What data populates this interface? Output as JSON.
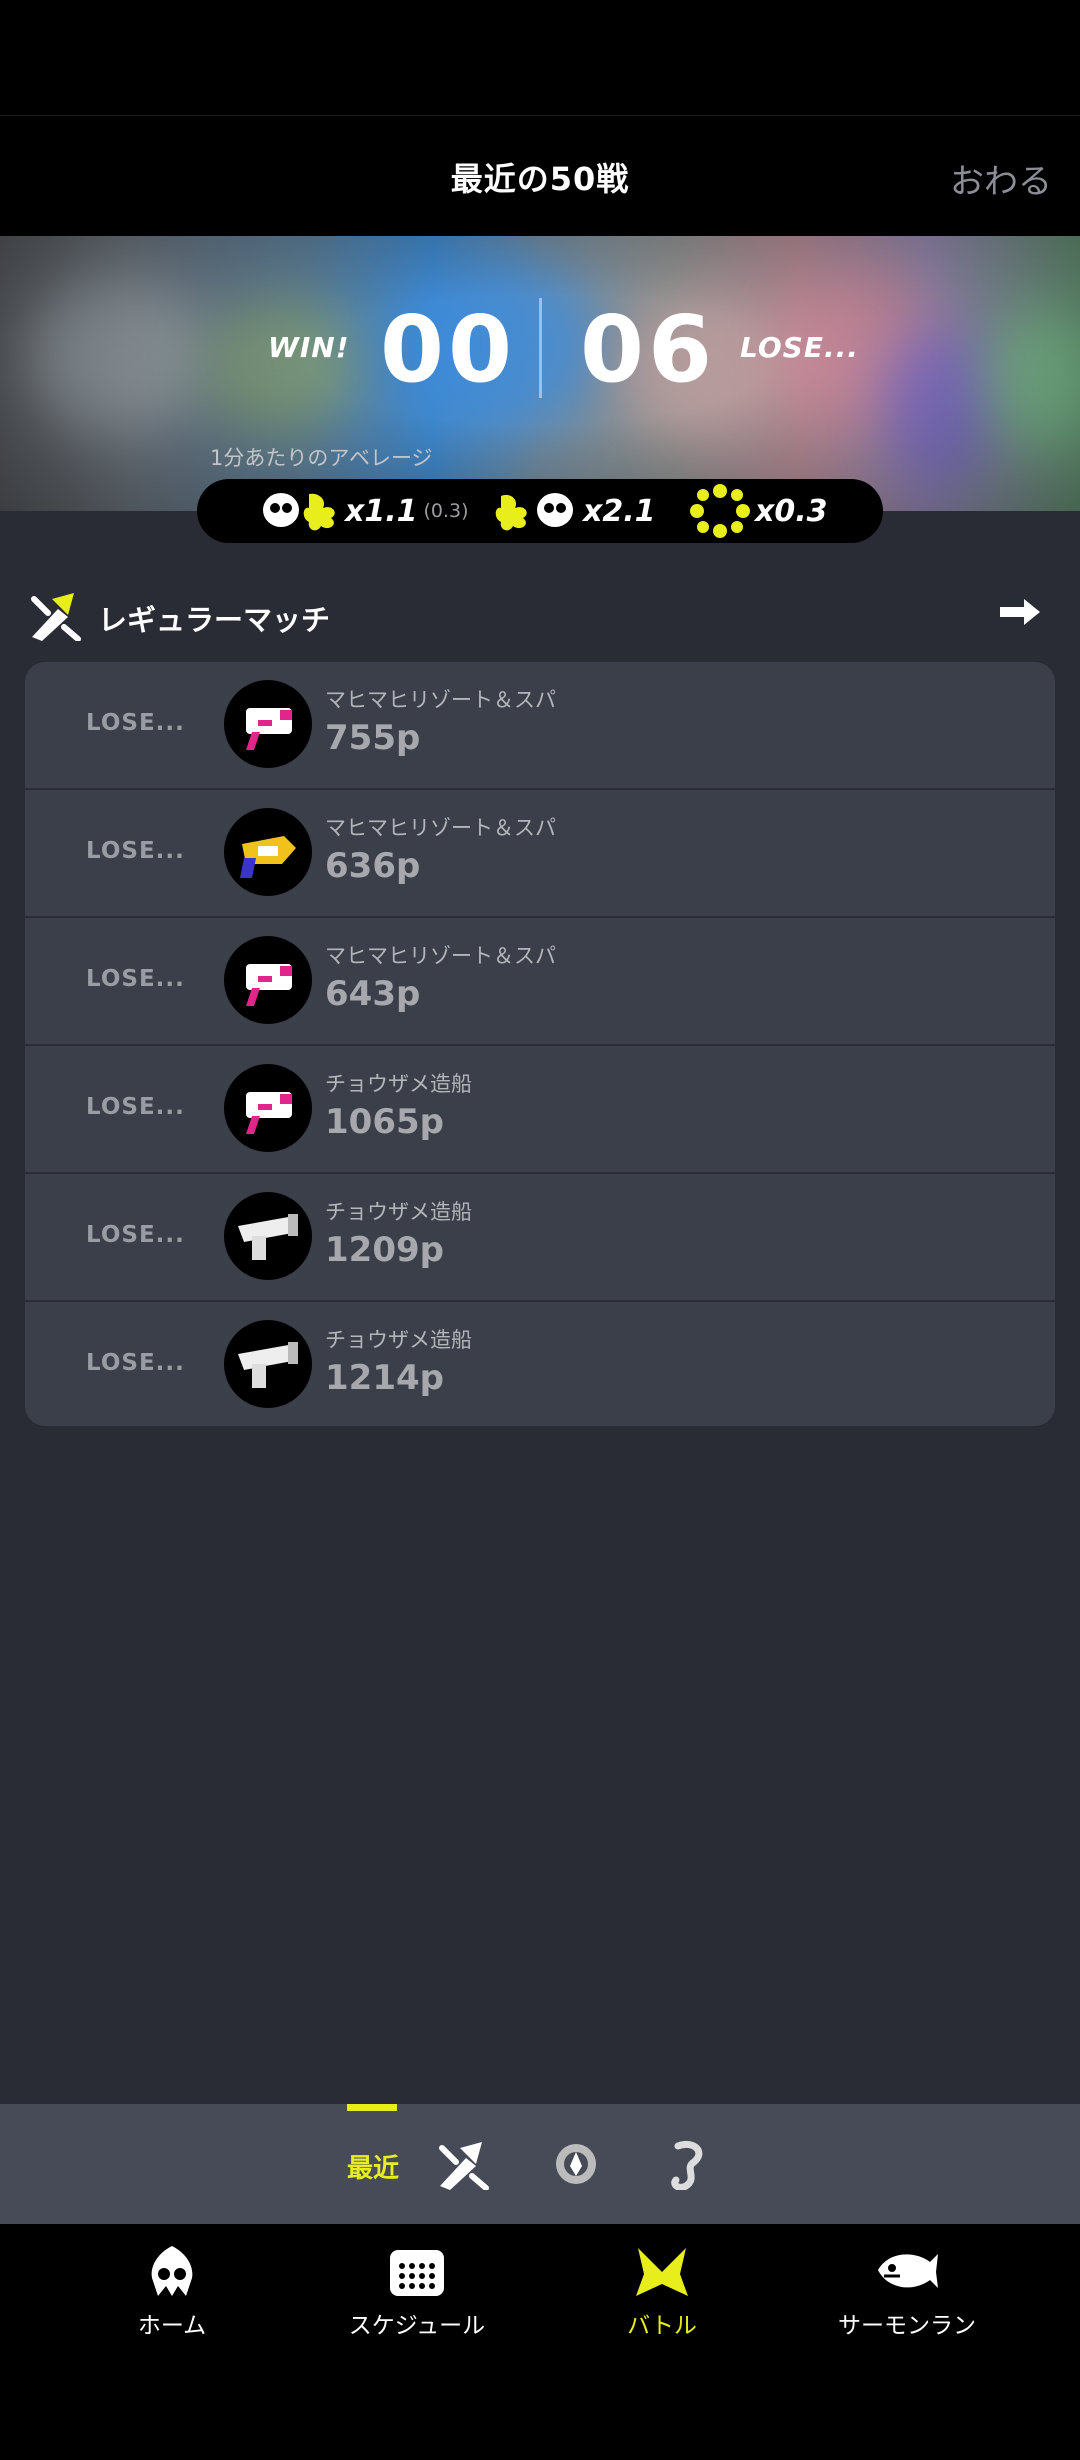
{
  "header": {
    "title": "最近の50戦",
    "close_label": "おわる"
  },
  "summary": {
    "win_label": "WIN!",
    "win_count": "00",
    "lose_label": "LOSE...",
    "lose_count": "06",
    "average_label": "1分あたりのアベレージ",
    "kills": "x1.1",
    "assists": "(0.3)",
    "deaths": "x2.1",
    "specials": "x0.3"
  },
  "section": {
    "title": "レギュラーマッチ"
  },
  "battles": [
    {
      "result": "LOSE...",
      "stage": "マヒマヒリゾート＆スパ",
      "points": "755p",
      "weapon": "splattershot-jr-icon"
    },
    {
      "result": "LOSE...",
      "stage": "マヒマヒリゾート＆スパ",
      "points": "636p",
      "weapon": "blaster-icon"
    },
    {
      "result": "LOSE...",
      "stage": "マヒマヒリゾート＆スパ",
      "points": "643p",
      "weapon": "splattershot-jr-icon"
    },
    {
      "result": "LOSE...",
      "stage": "チョウザメ造船",
      "points": "1065p",
      "weapon": "splattershot-jr-icon"
    },
    {
      "result": "LOSE...",
      "stage": "チョウザメ造船",
      "points": "1209p",
      "weapon": "roller-icon"
    },
    {
      "result": "LOSE...",
      "stage": "チョウザメ造船",
      "points": "1214p",
      "weapon": "roller-icon"
    }
  ],
  "subtabs": {
    "recent_label": "最近"
  },
  "nav": {
    "home": "ホーム",
    "schedule": "スケジュール",
    "battle": "バトル",
    "salmon": "サーモンラン"
  },
  "colors": {
    "accent": "#e8ee1c",
    "background": "#292c35",
    "card": "#3b3f49"
  }
}
